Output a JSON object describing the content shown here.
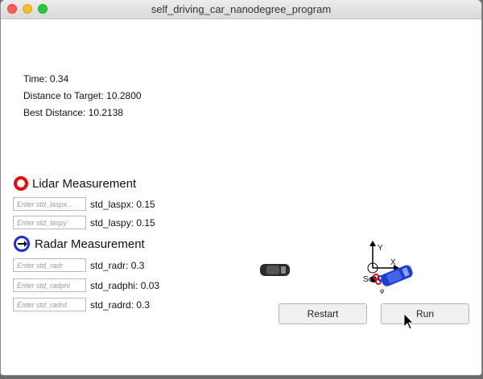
{
  "window": {
    "title": "self_driving_car_nanodegree_program"
  },
  "stats": {
    "time": "Time: 0.34",
    "distance_to_target": "Distance to Target: 10.2800",
    "best_distance": "Best Distance: 10.2138"
  },
  "lidar": {
    "heading": "Lidar Measurement",
    "fields": [
      {
        "placeholder": "Enter std_laspx...",
        "label": "std_laspx: 0.15"
      },
      {
        "placeholder": "Enter std_laspy",
        "label": "std_laspy: 0.15"
      }
    ]
  },
  "radar": {
    "heading": "Radar Measurement",
    "fields": [
      {
        "placeholder": "Enter std_radr",
        "label": "std_radr: 0.3"
      },
      {
        "placeholder": "Enter std_radphi",
        "label": "std_radphi: 0.03"
      },
      {
        "placeholder": "Enter std_radrd",
        "label": "std_radrd: 0.3"
      }
    ]
  },
  "scene": {
    "axis_y_label": "Y",
    "axis_x_label": "X",
    "sensor_label": "Se",
    "phi_label": "φ",
    "colors": {
      "target_car": "#2b2b2b",
      "hunter_car": "#1f3fd0",
      "lidar": "#e01010",
      "radar": "#1f2bd6"
    }
  },
  "buttons": {
    "restart": "Restart",
    "run": "Run"
  }
}
